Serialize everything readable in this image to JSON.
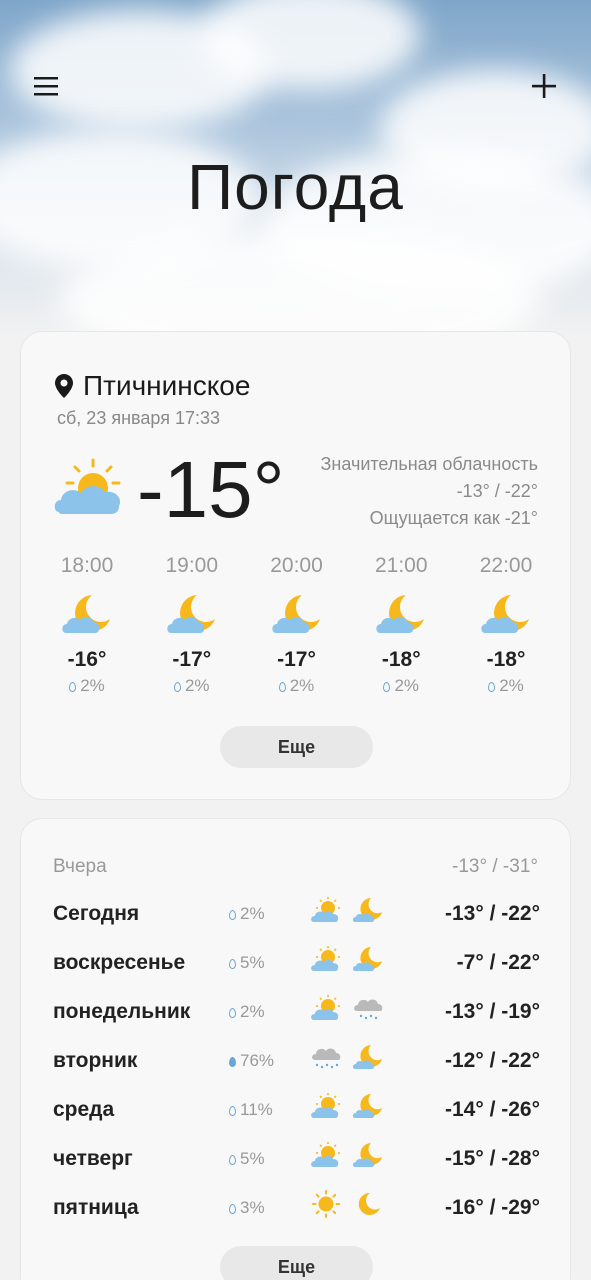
{
  "header": {
    "title": "Погода",
    "menu_icon": "hamburger-icon",
    "add_icon": "plus-icon"
  },
  "current": {
    "location": "Птичнинское",
    "datetime": "сб, 23 января 17:33",
    "temperature": "-15°",
    "condition": "Значительная облачность",
    "hi_lo": "-13° / -22°",
    "feels_like": "Ощущается как -21°",
    "icon": "partly-cloudy-day-icon"
  },
  "hourly": [
    {
      "time": "18:00",
      "temp": "-16°",
      "precip": "2%",
      "icon": "cloudy-night-icon"
    },
    {
      "time": "19:00",
      "temp": "-17°",
      "precip": "2%",
      "icon": "cloudy-night-icon"
    },
    {
      "time": "20:00",
      "temp": "-17°",
      "precip": "2%",
      "icon": "cloudy-night-icon"
    },
    {
      "time": "21:00",
      "temp": "-18°",
      "precip": "2%",
      "icon": "cloudy-night-icon"
    },
    {
      "time": "22:00",
      "temp": "-18°",
      "precip": "2%",
      "icon": "cloudy-night-icon"
    }
  ],
  "hourly_more_label": "Еще",
  "daily": {
    "yesterday_label": "Вчера",
    "yesterday_range": "-13° / -31°",
    "days": [
      {
        "name": "Сегодня",
        "precip": "2%",
        "day_icon": "partly-cloudy-day-icon",
        "night_icon": "cloudy-night-icon",
        "range": "-13° / -22°"
      },
      {
        "name": "воскресенье",
        "precip": "5%",
        "day_icon": "partly-cloudy-day-icon",
        "night_icon": "cloudy-night-icon",
        "range": "-7° / -22°"
      },
      {
        "name": "понедельник",
        "precip": "2%",
        "day_icon": "partly-cloudy-day-icon",
        "night_icon": "snow-cloud-icon",
        "range": "-13° / -19°"
      },
      {
        "name": "вторник",
        "precip": "76%",
        "day_icon": "snow-cloud-icon",
        "night_icon": "cloudy-night-icon",
        "range": "-12° / -22°"
      },
      {
        "name": "среда",
        "precip": "11%",
        "day_icon": "partly-cloudy-day-icon",
        "night_icon": "cloudy-night-icon",
        "range": "-14° / -26°"
      },
      {
        "name": "четверг",
        "precip": "5%",
        "day_icon": "partly-cloudy-day-icon",
        "night_icon": "cloudy-night-icon",
        "range": "-15° / -28°"
      },
      {
        "name": "пятница",
        "precip": "3%",
        "day_icon": "sun-icon",
        "night_icon": "moon-icon",
        "range": "-16° / -29°"
      }
    ],
    "more_label": "Еще"
  },
  "colors": {
    "sun": "#f7b81c",
    "cloud": "#8cc3ea",
    "moon": "#f7b81c",
    "gray_cloud": "#b9b9b9",
    "background": "#f2f2f2"
  }
}
